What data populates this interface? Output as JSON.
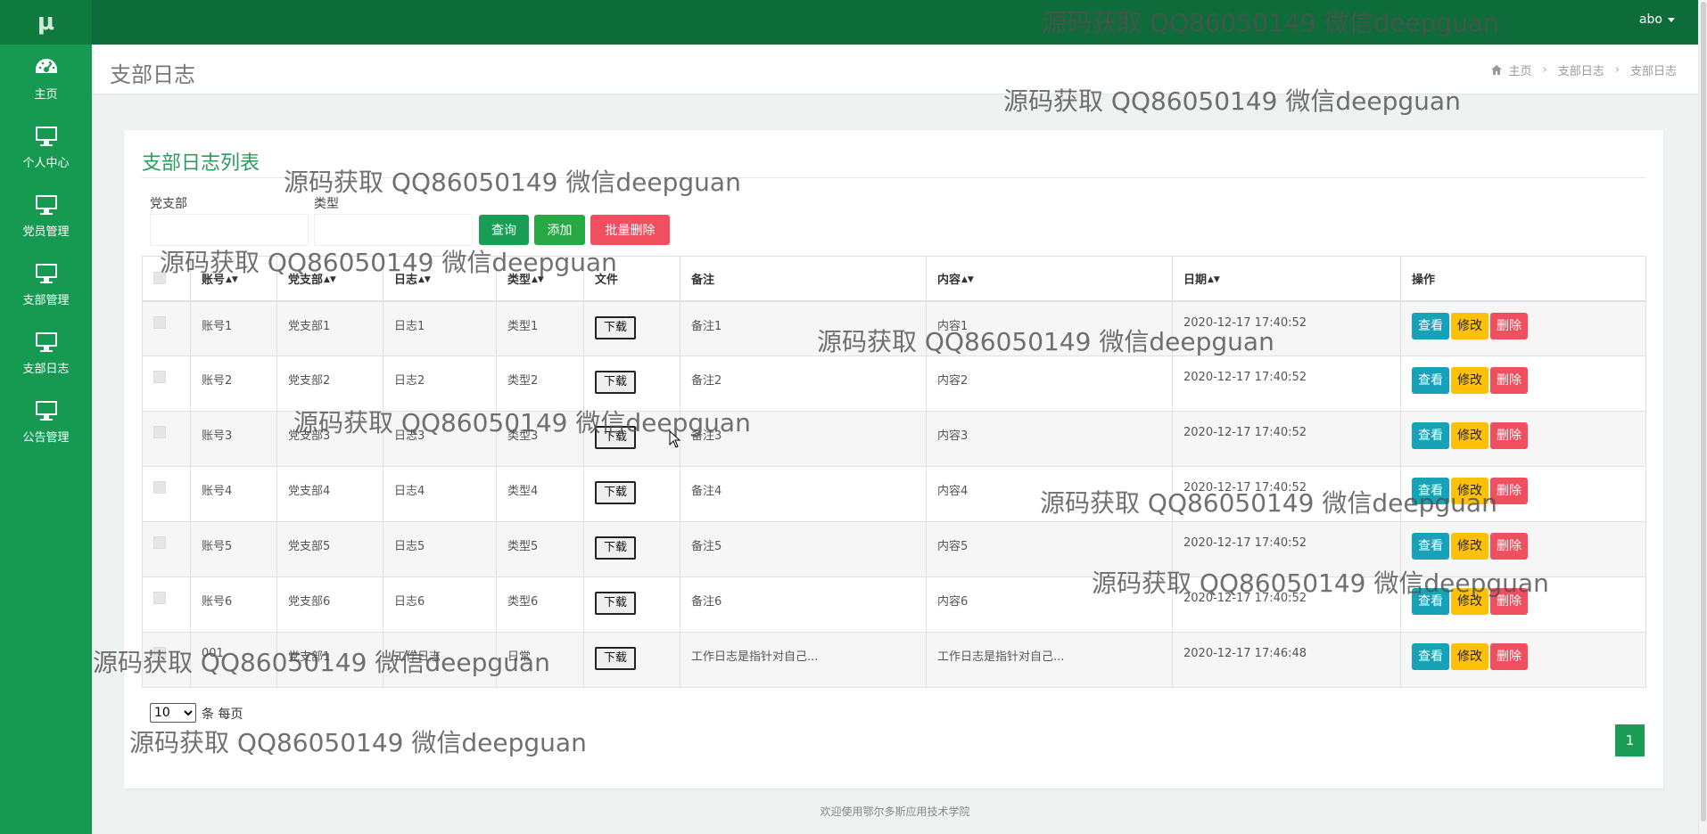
{
  "app": {
    "logo": "μ",
    "user": "abo"
  },
  "sidebar": {
    "items": [
      {
        "label": "主页",
        "icon": "dashboard-icon"
      },
      {
        "label": "个人中心",
        "icon": "monitor-icon"
      },
      {
        "label": "党员管理",
        "icon": "monitor-icon"
      },
      {
        "label": "支部管理",
        "icon": "monitor-icon"
      },
      {
        "label": "支部日志",
        "icon": "monitor-icon"
      },
      {
        "label": "公告管理",
        "icon": "monitor-icon"
      }
    ]
  },
  "header": {
    "title": "支部日志",
    "breadcrumb": [
      "主页",
      "支部日志",
      "支部日志"
    ]
  },
  "card": {
    "title": "支部日志列表",
    "filters": {
      "branch_label": "党支部",
      "branch_value": "",
      "type_label": "类型",
      "type_value": ""
    },
    "buttons": {
      "query": "查询",
      "add": "添加",
      "batch_delete": "批量删除"
    }
  },
  "table": {
    "columns": [
      "账号",
      "党支部",
      "日志",
      "类型",
      "文件",
      "备注",
      "内容",
      "日期",
      "操作"
    ],
    "download_label": "下载",
    "actions": {
      "view": "查看",
      "edit": "修改",
      "delete": "删除"
    },
    "rows": [
      {
        "account": "账号1",
        "branch": "党支部1",
        "log": "日志1",
        "type": "类型1",
        "remark": "备注1",
        "content": "内容1",
        "date": "2020-12-17 17:40:52"
      },
      {
        "account": "账号2",
        "branch": "党支部2",
        "log": "日志2",
        "type": "类型2",
        "remark": "备注2",
        "content": "内容2",
        "date": "2020-12-17 17:40:52"
      },
      {
        "account": "账号3",
        "branch": "党支部3",
        "log": "日志3",
        "type": "类型3",
        "remark": "备注3",
        "content": "内容3",
        "date": "2020-12-17 17:40:52"
      },
      {
        "account": "账号4",
        "branch": "党支部4",
        "log": "日志4",
        "type": "类型4",
        "remark": "备注4",
        "content": "内容4",
        "date": "2020-12-17 17:40:52"
      },
      {
        "account": "账号5",
        "branch": "党支部5",
        "log": "日志5",
        "type": "类型5",
        "remark": "备注5",
        "content": "内容5",
        "date": "2020-12-17 17:40:52"
      },
      {
        "account": "账号6",
        "branch": "党支部6",
        "log": "日志6",
        "type": "类型6",
        "remark": "备注6",
        "content": "内容6",
        "date": "2020-12-17 17:40:52"
      },
      {
        "account": "001",
        "branch": "党支部1",
        "log": "工作日志",
        "type": "日常",
        "remark": "工作日志是指针对自己...",
        "content": "工作日志是指针对自己...",
        "date": "2020-12-17 17:46:48"
      }
    ]
  },
  "pagination": {
    "page_size": "10",
    "page_size_suffix": "条 每页",
    "current_page": "1"
  },
  "footer": {
    "text": "欢迎使用鄂尔多斯应用技术学院"
  },
  "watermark": {
    "text": "源码获取 QQ86050149 微信deepguan"
  },
  "colors": {
    "sidebar": "#169a51",
    "topbar": "#0e6b3a",
    "view": "#17a2b8",
    "edit": "#ffc107",
    "delete": "#f04f5f",
    "query": "#1a9d55",
    "batch_delete": "#f04f5f"
  }
}
